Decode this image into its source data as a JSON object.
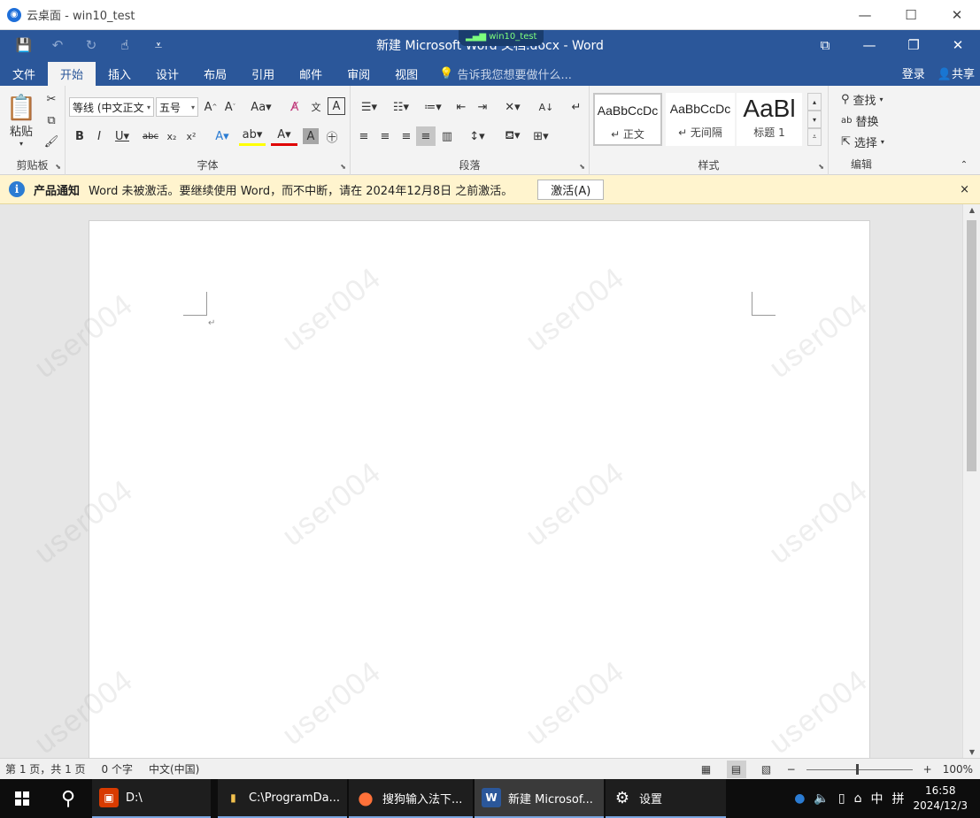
{
  "remote_window": {
    "title": "云桌面 - win10_test",
    "controls": [
      "—",
      "☐",
      "✕"
    ]
  },
  "word": {
    "title": "新建 Microsoft Word 文档.docx - Word",
    "signal_label": "win10_test",
    "qat": {
      "save": "💾",
      "undo": "↶",
      "redo": "↻",
      "touch": "☝",
      "more": "⩡"
    },
    "window_controls": [
      "⧉",
      "—",
      "❐",
      "✕"
    ]
  },
  "tabs": [
    "文件",
    "开始",
    "插入",
    "设计",
    "布局",
    "引用",
    "邮件",
    "审阅",
    "视图"
  ],
  "active_tab": "开始",
  "tell_me": "告诉我您想要做什么...",
  "login": "登录",
  "share": "共享",
  "ribbon": {
    "clipboard": {
      "label": "剪贴板",
      "paste": "粘贴"
    },
    "font": {
      "label": "字体",
      "font_name": "等线 (中文正文",
      "font_size": "五号"
    },
    "paragraph": {
      "label": "段落"
    },
    "styles": {
      "label": "样式",
      "items": [
        {
          "sample": "AaBbCcDc",
          "name": "↵ 正文"
        },
        {
          "sample": "AaBbCcDc",
          "name": "↵ 无间隔"
        },
        {
          "sample": "AaBl",
          "name": "标题 1"
        }
      ]
    },
    "editing": {
      "label": "编辑",
      "find": "查找",
      "replace": "替换",
      "select": "选择"
    }
  },
  "notification": {
    "title": "产品通知",
    "message": "Word 未被激活。要继续使用 Word，而不中断，请在 2024年12月8日 之前激活。",
    "button": "激活(A)",
    "close": "×"
  },
  "watermark_text": "user004",
  "status": {
    "page": "第 1 页，共 1 页",
    "words": "0 个字",
    "language": "中文(中国)",
    "zoom": "100%"
  },
  "taskbar": {
    "apps": [
      {
        "label": "D:\\",
        "icon": "▣",
        "color": "#d83b01"
      },
      {
        "label": "C:\\ProgramDa...",
        "icon": "▮",
        "color": "#f2c14e"
      },
      {
        "label": "搜狗输入法下...",
        "icon": "●",
        "color": "#ff7139"
      },
      {
        "label": "新建 Microsof...",
        "icon": "W",
        "color": "#2b579a"
      },
      {
        "label": "设置",
        "icon": "⚙",
        "color": "transparent"
      }
    ],
    "ime": "中",
    "ime2": "拼",
    "time": "16:58",
    "date": "2024/12/3"
  }
}
